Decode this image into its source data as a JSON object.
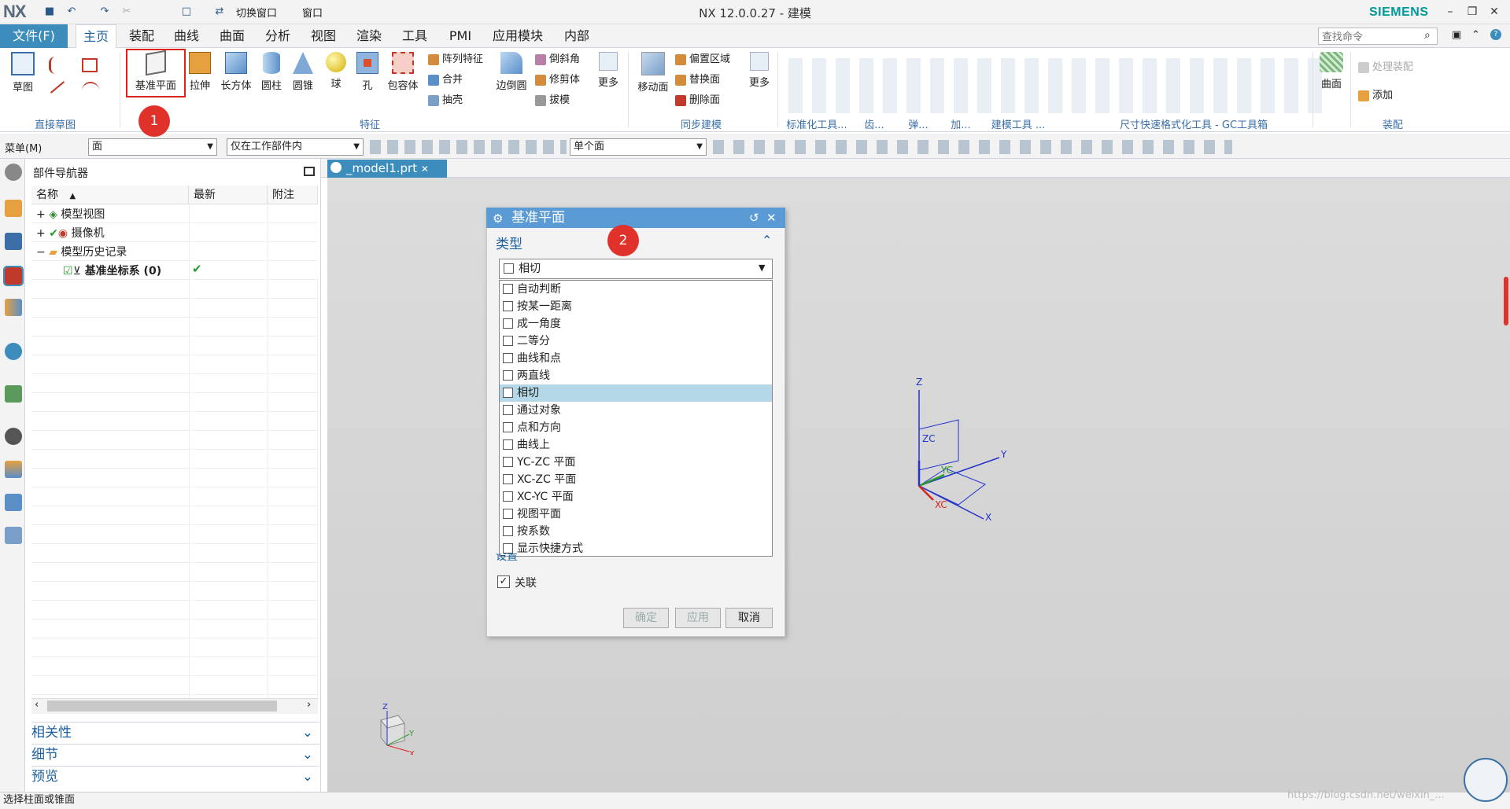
{
  "titlebar": {
    "logo": "NX",
    "title": "NX 12.0.0.27 - 建模",
    "brand": "SIEMENS",
    "switch_window": "切换窗口",
    "window": "窗口"
  },
  "menu": {
    "file": "文件(F)",
    "tabs": [
      "主页",
      "装配",
      "曲线",
      "曲面",
      "分析",
      "视图",
      "渲染",
      "工具",
      "PMI",
      "应用模块",
      "内部"
    ],
    "search_placeholder": "查找命令"
  },
  "ribbon": {
    "sketch": "草图",
    "direct_sketch": "直接草图",
    "features": [
      "基准平面",
      "拉伸",
      "长方体",
      "圆柱",
      "圆锥",
      "球",
      "孔",
      "包容体"
    ],
    "small1": [
      "阵列特征",
      "合并",
      "抽壳"
    ],
    "side": "边倒圆",
    "small2": [
      "倒斜角",
      "修剪体",
      "拔模"
    ],
    "more": "更多",
    "feature_group": "特征",
    "move_face": "移动面",
    "small3": [
      "偏置区域",
      "替换面",
      "删除面"
    ],
    "more2": "更多",
    "sync_group": "同步建模",
    "g_std": "标准化工具...",
    "g_gear": "齿...",
    "g_spring": "弹...",
    "g_add": "加...",
    "g_model": "建模工具 ...",
    "g_dim": "尺寸快速格式化工具 - GC工具箱",
    "surface": "曲面",
    "process_asm": "处理装配",
    "add": "添加",
    "asm_group": "装配"
  },
  "selbar": {
    "menu": "菜单(M)",
    "filter": "面",
    "scope": "仅在工作部件内",
    "face_rule": "单个面"
  },
  "navigator": {
    "title": "部件导航器",
    "cols": [
      "名称",
      "最新",
      "附注"
    ],
    "rows": [
      "模型视图",
      "摄像机",
      "模型历史记录",
      "基准坐标系 (0)"
    ],
    "sections": [
      "相关性",
      "细节",
      "预览"
    ]
  },
  "doc_tab": "_model1.prt",
  "dialog": {
    "title": "基准平面",
    "type_label": "类型",
    "selected": "相切",
    "options": [
      "自动判断",
      "按某一距离",
      "成一角度",
      "二等分",
      "曲线和点",
      "两直线",
      "相切",
      "通过对象",
      "点和方向",
      "曲线上",
      "YC-ZC 平面",
      "XC-ZC 平面",
      "XC-YC 平面",
      "视图平面",
      "按系数",
      "显示快捷方式"
    ],
    "settings": "设置",
    "assoc": "关联",
    "ok": "确定",
    "apply": "应用",
    "cancel": "取消"
  },
  "badges": [
    "1",
    "2"
  ],
  "axes": {
    "z": "Z",
    "zc": "ZC",
    "yc": "YC",
    "y": "Y",
    "xc": "XC",
    "x": "X"
  },
  "status": "选择柱面或锥面",
  "watermark": "https://blog.csdn.net/weixin_..."
}
